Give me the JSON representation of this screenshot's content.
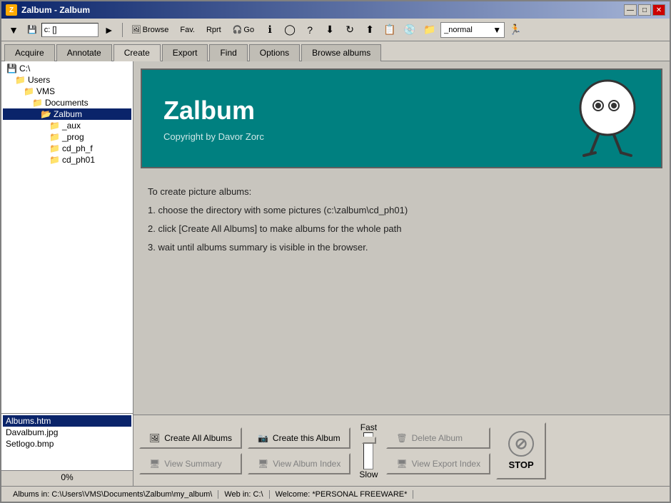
{
  "window": {
    "title": "Zalbum - Zalbum",
    "icon": "Z"
  },
  "titlebar": {
    "minimize_label": "—",
    "restore_label": "□",
    "close_label": "✕"
  },
  "toolbar": {
    "back_label": "◄",
    "forward_label": "►",
    "path_label": "c: []",
    "browse_label": "Browse",
    "fav_label": "Fav.",
    "rprt_label": "Rprt",
    "go_label": "Go",
    "normal_combo": "_normal",
    "run_icon": "►"
  },
  "tabs": [
    {
      "id": "acquire",
      "label": "Acquire"
    },
    {
      "id": "annotate",
      "label": "Annotate"
    },
    {
      "id": "create",
      "label": "Create"
    },
    {
      "id": "export",
      "label": "Export"
    },
    {
      "id": "find",
      "label": "Find"
    },
    {
      "id": "options",
      "label": "Options"
    },
    {
      "id": "browse-albums",
      "label": "Browse albums"
    }
  ],
  "active_tab": "create",
  "tree": {
    "items": [
      {
        "id": "c-drive",
        "label": "C:\\",
        "indent": 0,
        "selected": false
      },
      {
        "id": "users",
        "label": "Users",
        "indent": 1,
        "selected": false
      },
      {
        "id": "vms",
        "label": "VMS",
        "indent": 2,
        "selected": false
      },
      {
        "id": "documents",
        "label": "Documents",
        "indent": 3,
        "selected": false
      },
      {
        "id": "zalbum",
        "label": "Zalbum",
        "indent": 4,
        "selected": true
      },
      {
        "id": "aux",
        "label": "_aux",
        "indent": 5,
        "selected": false
      },
      {
        "id": "prog",
        "label": "_prog",
        "indent": 5,
        "selected": false
      },
      {
        "id": "cd_ph_f",
        "label": "cd_ph_f",
        "indent": 5,
        "selected": false
      },
      {
        "id": "cd_ph01",
        "label": "cd_ph01",
        "indent": 5,
        "selected": false
      }
    ]
  },
  "files": [
    {
      "id": "albums-htm",
      "label": "Albums.htm",
      "selected": true
    },
    {
      "id": "davalbum-jpg",
      "label": "Davalbum.jpg",
      "selected": false
    },
    {
      "id": "setlogo-bmp",
      "label": "Setlogo.bmp",
      "selected": false
    }
  ],
  "percent": "0%",
  "banner": {
    "title": "Zalbum",
    "subtitle": "Copyright by Davor Zorc"
  },
  "instructions": {
    "header": "To create picture albums:",
    "step1": "1. choose the directory with some pictures (c:\\zalbum\\cd_ph01)",
    "step2": "2. click [Create All Albums] to make albums for the whole path",
    "step3": "3. wait until albums summary is visible in the browser."
  },
  "buttons": {
    "create_all_albums": "Create All Albums",
    "create_this_album": "Create this Album",
    "view_summary": "View Summary",
    "view_album_index": "View Album Index",
    "delete_album": "Delete Album",
    "view_export_index": "View Export Index",
    "fast_label": "Fast",
    "slow_label": "Slow",
    "stop_label": "STOP"
  },
  "status_bar": {
    "albums_path": "Albums in: C:\\Users\\VMS\\Documents\\Zalbum\\my_album\\",
    "web_path": "Web in: C:\\",
    "welcome": "Welcome: *PERSONAL FREEWARE*"
  }
}
